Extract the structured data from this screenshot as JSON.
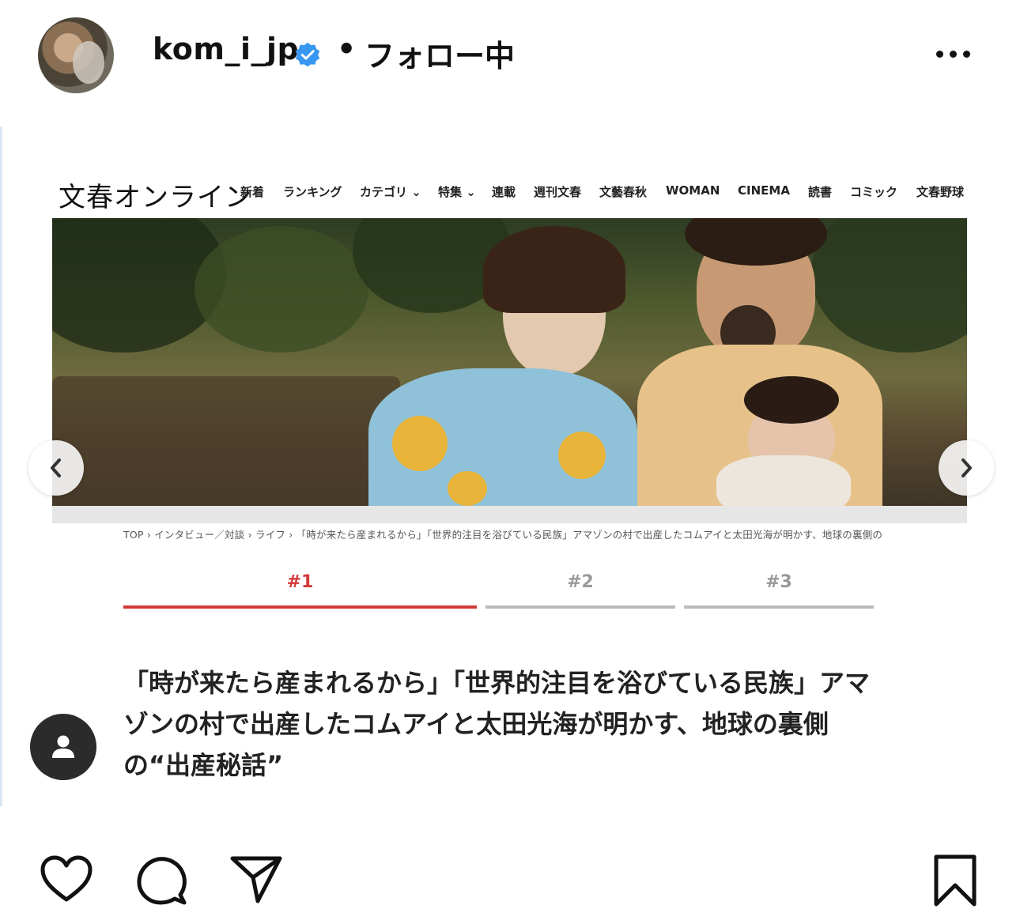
{
  "post": {
    "username": "kom_i_jp",
    "separator": "•",
    "follow_status": "フォロー中",
    "verified_icon": "verified-badge-icon",
    "more_icon": "more-horizontal-icon"
  },
  "article": {
    "site_logo": "文春オンライン",
    "nav": [
      "新着",
      "ランキング",
      "カテゴリ ⌄",
      "特集 ⌄",
      "連載",
      "週刊文春",
      "文藝春秋",
      "WOMAN",
      "CINEMA",
      "読書",
      "コミック",
      "文春野球"
    ],
    "breadcrumb": "TOP › インタビュー／対談 › ライフ › 「時が来たら産まれるから」「世界的注目を浴びている民族」アマゾンの村で出産したコムアイと太田光海が明かす、地球の裏側の",
    "tabs": [
      {
        "label": "#1",
        "active": true
      },
      {
        "label": "#2",
        "active": false
      },
      {
        "label": "#3",
        "active": false
      }
    ],
    "headline": "「時が来たら産まれるから」「世界的注目を浴びている民族」アマゾンの村で出産したコムアイと太田光海が明かす、地球の裏側の“出産秘話”"
  },
  "carousel": {
    "prev_icon": "chevron-left-icon",
    "next_icon": "chevron-right-icon"
  },
  "tagged_icon": "user-tag-icon",
  "actions": {
    "like_icon": "heart-icon",
    "comment_icon": "comment-icon",
    "share_icon": "send-icon",
    "save_icon": "bookmark-icon"
  },
  "colors": {
    "accent_red": "#d33a3a",
    "verified_blue": "#3897f0",
    "tab_inactive": "#bbbbbb"
  }
}
